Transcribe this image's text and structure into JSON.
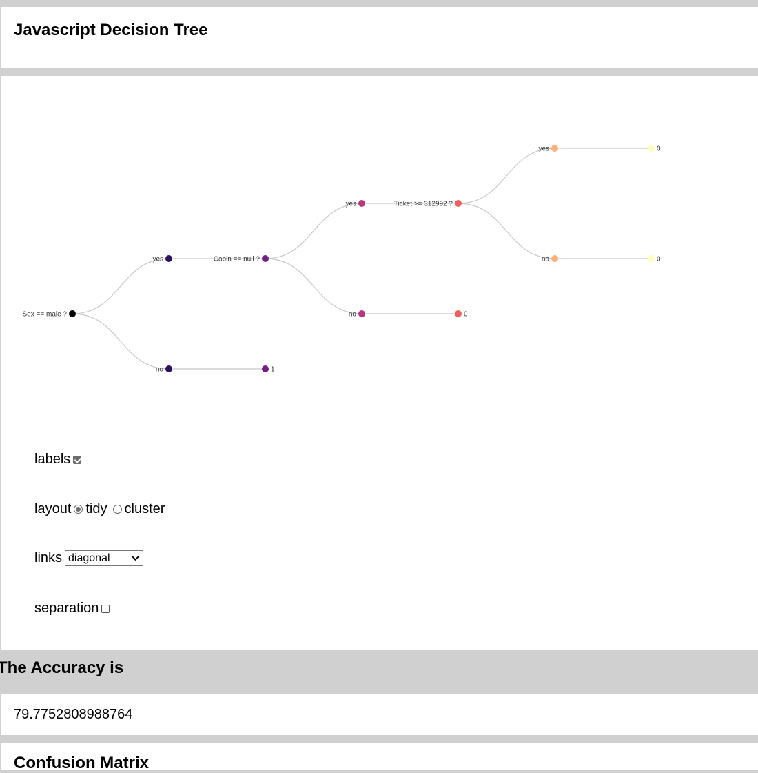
{
  "header": {
    "title": "Javascript Decision Tree"
  },
  "tree": {
    "nodes": [
      {
        "id": "root",
        "label": "Sex == male ?",
        "label_side": "left",
        "color": "#000004"
      },
      {
        "id": "n_yes",
        "label": "yes",
        "label_side": "left",
        "color": "#2c115f"
      },
      {
        "id": "n_no",
        "label": "no",
        "label_side": "left",
        "color": "#2c115f"
      },
      {
        "id": "cabin",
        "label": "Cabin == null ?",
        "label_side": "left",
        "color": "#721f81"
      },
      {
        "id": "leaf_1",
        "label": "1",
        "label_side": "right",
        "color": "#721f81"
      },
      {
        "id": "c_yes",
        "label": "yes",
        "label_side": "left",
        "color": "#b73779"
      },
      {
        "id": "c_no",
        "label": "no",
        "label_side": "left",
        "color": "#b73779"
      },
      {
        "id": "ticket",
        "label": "Ticket >= 312992 ?",
        "label_side": "left",
        "color": "#f1605d"
      },
      {
        "id": "leaf_c0",
        "label": "0",
        "label_side": "right",
        "color": "#f1605d"
      },
      {
        "id": "t_yes",
        "label": "yes",
        "label_side": "left",
        "color": "#feb078"
      },
      {
        "id": "t_no",
        "label": "no",
        "label_side": "left",
        "color": "#feb078"
      },
      {
        "id": "leaf_t0a",
        "label": "0",
        "label_side": "right",
        "color": "#fcfdbf"
      },
      {
        "id": "leaf_t0b",
        "label": "0",
        "label_side": "right",
        "color": "#fcfdbf"
      }
    ],
    "links": [
      [
        "root",
        "n_yes"
      ],
      [
        "root",
        "n_no"
      ],
      [
        "n_yes",
        "cabin"
      ],
      [
        "n_no",
        "leaf_1"
      ],
      [
        "cabin",
        "c_yes"
      ],
      [
        "cabin",
        "c_no"
      ],
      [
        "c_yes",
        "ticket"
      ],
      [
        "c_no",
        "leaf_c0"
      ],
      [
        "ticket",
        "t_yes"
      ],
      [
        "ticket",
        "t_no"
      ],
      [
        "t_yes",
        "leaf_t0a"
      ],
      [
        "t_no",
        "leaf_t0b"
      ]
    ],
    "link_color": "#c8c8c8"
  },
  "controls": {
    "labels": {
      "label": "labels",
      "checked": true
    },
    "layout": {
      "label": "layout",
      "options": [
        "tidy",
        "cluster"
      ],
      "selected": "tidy"
    },
    "links": {
      "label": "links",
      "selected": "diagonal"
    },
    "separation": {
      "label": "separation",
      "checked": false
    }
  },
  "accuracy": {
    "heading": "The Accuracy is",
    "value": "79.7752808988764"
  },
  "matrix": {
    "heading": "Confusion Matrix"
  }
}
